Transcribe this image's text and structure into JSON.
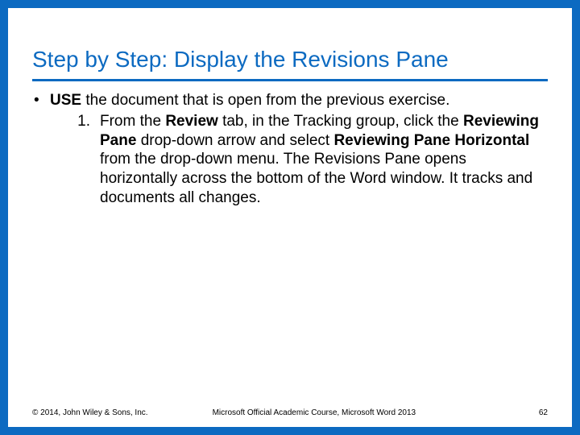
{
  "title": "Step by Step: Display the Revisions Pane",
  "bullet": {
    "marker": "•",
    "lead_bold": "USE",
    "lead_rest": " the document that is open from the previous exercise."
  },
  "step1": {
    "marker": "1.",
    "t1": "From the ",
    "t2": "Review",
    "t3": " tab, in the Tracking group, click the ",
    "t4": "Reviewing Pane ",
    "t5": "drop-down arrow and select ",
    "t6": "Reviewing Pane Horizontal ",
    "t7": "from the drop-down menu. The Revisions Pane opens horizontally across the bottom of the Word window. It tracks and documents all changes."
  },
  "footer": {
    "copyright": "© 2014, John Wiley & Sons, Inc.",
    "center": "Microsoft Official Academic Course, Microsoft Word 2013",
    "page": "62"
  }
}
